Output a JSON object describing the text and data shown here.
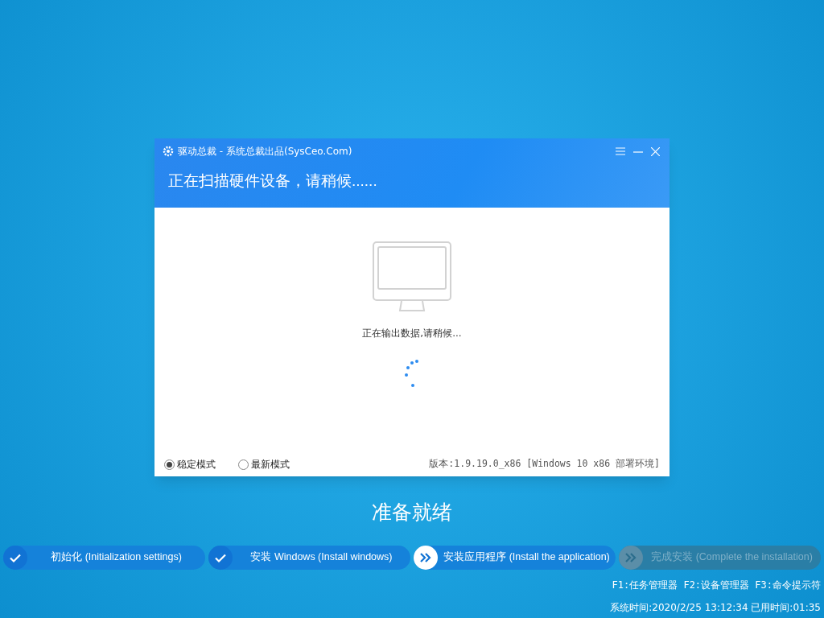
{
  "window": {
    "title": "驱动总裁 - 系统总裁出品(SysCeo.Com)",
    "heading": "正在扫描硬件设备，请稍候......",
    "status": "正在输出数据,请稍候...",
    "modes": [
      {
        "label": "稳定模式",
        "selected": true
      },
      {
        "label": "最新模式",
        "selected": false
      }
    ],
    "version": "版本:1.9.19.0_x86 [Windows 10 x86 部署环境]"
  },
  "caption": "准备就绪",
  "steps": [
    {
      "label": "初始化 (Initialization settings)",
      "kind": "done"
    },
    {
      "label": "安装 Windows (Install windows)",
      "kind": "done"
    },
    {
      "label": "安装应用程序 (Install the application)",
      "kind": "current"
    },
    {
      "label": "完成安装 (Complete the installation)",
      "kind": "pending"
    }
  ],
  "hotkeys": "F1:任务管理器 F2:设备管理器 F3:命令提示符",
  "clock": "系统时间:2020/2/25 13:12:34 已用时间:01:35"
}
